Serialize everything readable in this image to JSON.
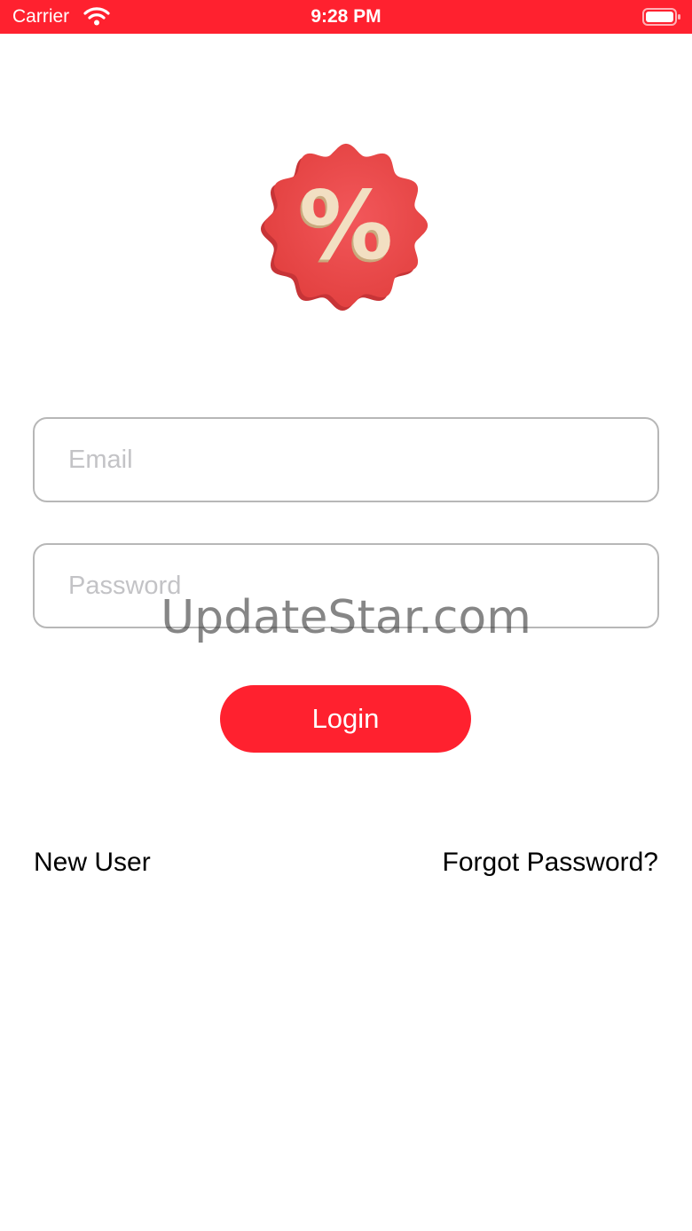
{
  "status_bar": {
    "carrier": "Carrier",
    "time": "9:28 PM",
    "icons": [
      "wifi-icon",
      "battery-icon"
    ],
    "background_color": "#ff212f"
  },
  "logo": {
    "icon": "discount-badge-icon",
    "symbol": "%",
    "badge_color": "#ee4a4f",
    "symbol_color": "#f2dfc2"
  },
  "form": {
    "email_placeholder": "Email",
    "email_value": "",
    "password_placeholder": "Password",
    "password_value": "",
    "login_label": "Login",
    "accent_color": "#ff212f"
  },
  "links": {
    "new_user": "New User",
    "forgot_password": "Forgot Password?"
  },
  "watermark": "UpdateStar.com"
}
